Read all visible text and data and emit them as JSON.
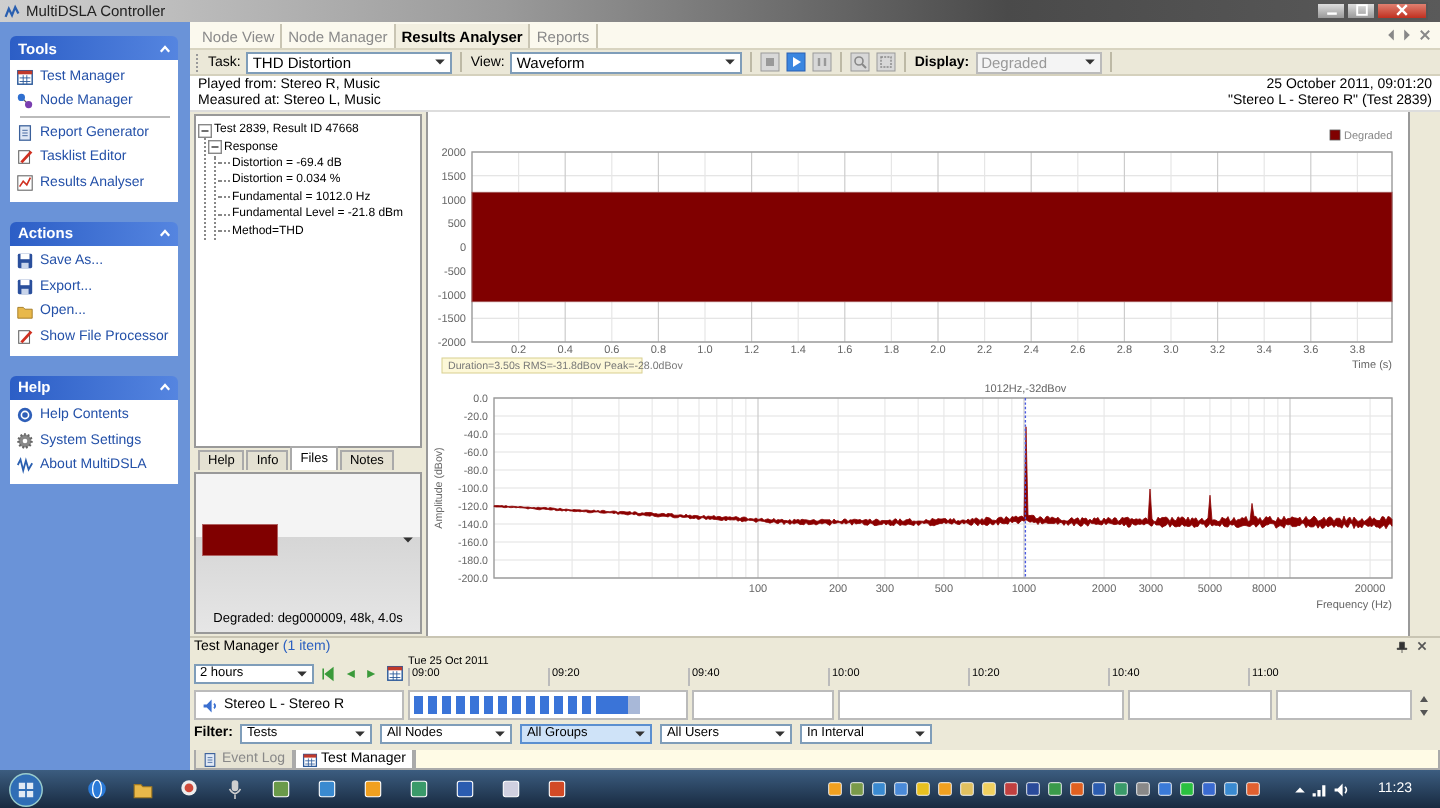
{
  "window": {
    "title": "MultiDSLA Controller"
  },
  "sidebar": {
    "panels": [
      {
        "title": "Tools",
        "expanded": true,
        "groups": [
          [
            "Test Manager",
            "Node Manager"
          ],
          [
            "Report Generator",
            "Tasklist Editor",
            "Results Analyser"
          ]
        ]
      },
      {
        "title": "Actions",
        "expanded": true,
        "groups": [
          [
            "Save As...",
            "Export...",
            "Open...",
            "Show File Processor"
          ]
        ]
      },
      {
        "title": "Help",
        "expanded": true,
        "groups": [
          [
            "Help Contents",
            "System Settings",
            "About MultiDSLA"
          ]
        ]
      }
    ]
  },
  "main_tabs": [
    {
      "label": "Node View",
      "selected": false
    },
    {
      "label": "Node Manager",
      "selected": false
    },
    {
      "label": "Results Analyser",
      "selected": true
    },
    {
      "label": "Reports",
      "selected": false
    }
  ],
  "toolbar": {
    "task_label": "Task:",
    "task": "THD Distortion",
    "view_label": "View:",
    "view": "Waveform",
    "display_label": "Display:",
    "display": {
      "value": "Degraded",
      "disabled": true
    }
  },
  "header": {
    "played_from": "Played from: Stereo R, Music",
    "measured_at": "Measured at: Stereo L, Music",
    "timestamp": "25 October 2011, 09:01:20",
    "test": "\"Stereo L - Stereo R\" (Test 2839)"
  },
  "tree": [
    {
      "label": "Test 2839, Result ID 47668",
      "expanded": true,
      "children": [
        {
          "label": "Response",
          "expanded": true,
          "children": [
            {
              "label": "Distortion = -69.4 dB"
            },
            {
              "label": "Distortion = 0.034 %"
            },
            {
              "label": "Fundamental = 1012.0 Hz"
            },
            {
              "label": "Fundamental Level = -21.8 dBm"
            },
            {
              "label": "Method=THD"
            }
          ]
        }
      ]
    }
  ],
  "pane_tabs": [
    {
      "label": "Help",
      "selected": false
    },
    {
      "label": "Info",
      "selected": false
    },
    {
      "label": "Files",
      "selected": true
    },
    {
      "label": "Notes",
      "selected": false
    }
  ],
  "file_preview": {
    "caption": "Degraded: deg000009, 48k, 4.0s"
  },
  "waveform": {
    "legend": "Degraded",
    "y_ticks": [
      "2000",
      "1500",
      "1000",
      "500",
      "0",
      "-500",
      "-1000",
      "-1500",
      "-2000"
    ],
    "x_ticks": [
      "0.2",
      "0.4",
      "0.6",
      "0.8",
      "1.0",
      "1.2",
      "1.4",
      "1.6",
      "1.8",
      "2.0",
      "2.2",
      "2.4",
      "2.6",
      "2.8",
      "3.0",
      "3.2",
      "3.4",
      "3.6",
      "3.8"
    ],
    "x_label": "Time (s)",
    "readout": "Duration=3.50s  RMS=-31.8dBov  Peak=-28.0dBov"
  },
  "spectrum": {
    "title": "1012Hz,-32dBov",
    "y_label": "Amplitude (dBov)",
    "y_ticks": [
      "0.0",
      "-20.0",
      "-40.0",
      "-60.0",
      "-80.0",
      "-100.0",
      "-120.0",
      "-140.0",
      "-160.0",
      "-180.0",
      "-200.0"
    ],
    "x_ticks": [
      "100",
      "200",
      "300",
      "500",
      "1000",
      "2000",
      "3000",
      "5000",
      "8000",
      "20000"
    ],
    "x_label": "Frequency (Hz)"
  },
  "test_manager": {
    "title": "Test Manager",
    "count": "(1 item)",
    "range": "2 hours",
    "date": "Tue 25 Oct 2011",
    "times": [
      "09:00",
      "09:20",
      "09:40",
      "10:00",
      "10:20",
      "10:40",
      "11:00"
    ],
    "rows": [
      {
        "label": "Stereo L - Stereo R"
      }
    ],
    "filter_label": "Filter:",
    "filters": [
      {
        "value": "Tests",
        "selected": false
      },
      {
        "value": "All Nodes",
        "selected": false
      },
      {
        "value": "All Groups",
        "selected": true
      },
      {
        "value": "All Users",
        "selected": false
      },
      {
        "value": "In Interval",
        "selected": false
      }
    ]
  },
  "bottom_tabs": [
    {
      "label": "Event Log",
      "selected": false
    },
    {
      "label": "Test Manager",
      "selected": true
    }
  ],
  "taskbar": {
    "clock": "11:23"
  }
}
